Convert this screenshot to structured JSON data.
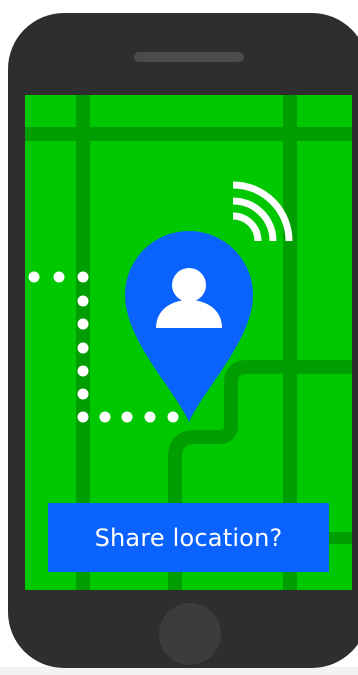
{
  "colors": {
    "phone_body": "#2e2e2e",
    "map_background": "#00c800",
    "road": "#009e00",
    "pin": "#0a62ff",
    "route_dots": "#ffffff",
    "signal_icon": "#ffffff",
    "button_background": "#0a62ff",
    "button_text": "#ffffff"
  },
  "prompt": {
    "label": "Share location?"
  },
  "icons": {
    "pin": "map-pin-icon",
    "user": "user-icon",
    "signal": "wifi-signal-icon",
    "route": "dotted-route"
  }
}
